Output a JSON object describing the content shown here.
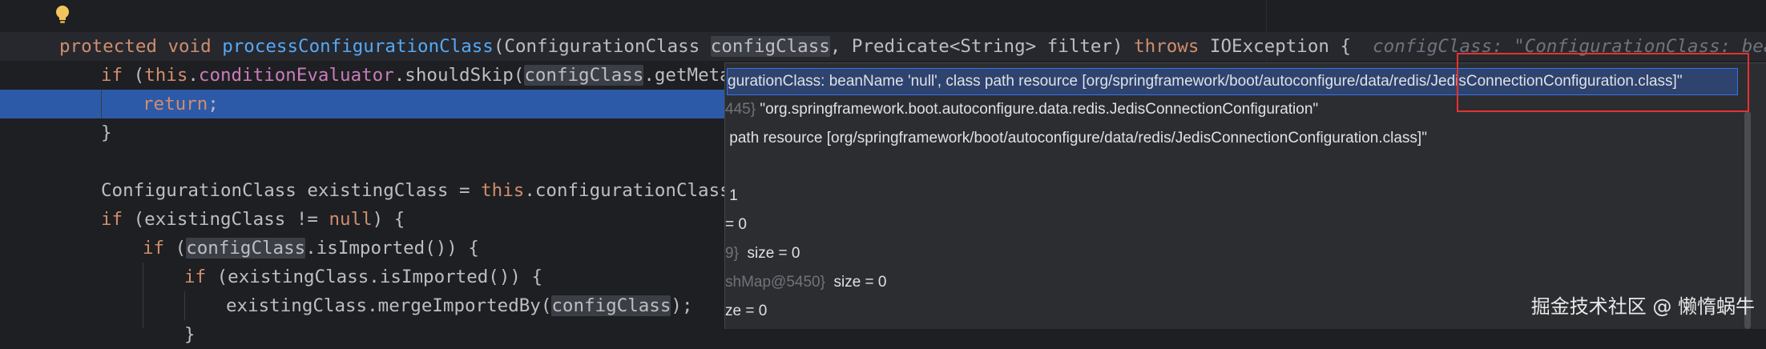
{
  "code": {
    "line1": {
      "kw1": "protected",
      "kw2": "void",
      "method": "processConfigurationClass",
      "paren_open": "(",
      "type1": "ConfigurationClass ",
      "param1": "configClass",
      "rest": ", Predicate<String> filter) ",
      "throws": "throws",
      "exc": " IOException {",
      "hint_name": "configClass: ",
      "hint_value": "\"ConfigurationClass: beanName"
    },
    "line2": {
      "if": "if",
      "open": " (",
      "this": "this",
      "dot": ".",
      "field": "conditionEvaluator",
      "call": ".shouldSkip(",
      "param": "configClass",
      "tail": ".getMetada"
    },
    "line3": {
      "kw": "return",
      "semi": ";"
    },
    "line4": {
      "text": "}"
    },
    "line6": {
      "type": "ConfigurationClass existingClass = ",
      "this": "this",
      "tail": ".configurationClasses"
    },
    "line7": {
      "if": "if",
      "tail": " (existingClass != ",
      "null": "null",
      "end": ") {"
    },
    "line8": {
      "if": "if",
      "open": " (",
      "param": "configClass",
      "tail": ".isImported()) {"
    },
    "line9": {
      "if": "if",
      "tail": " (existingClass.isImported()) {"
    },
    "line10": {
      "head": "existingClass.mergeImportedBy(",
      "param": "configClass",
      "tail": ");"
    },
    "line11": {
      "text": "}"
    }
  },
  "popup": {
    "rows": [
      {
        "text": "gurationClass: beanName 'null', class path resource [org/springframework/boot/autoconfigure/data/redis/JedisConnectionConfiguration.class]\""
      },
      {
        "dim": "445}",
        "text": " \"org.springframework.boot.autoconfigure.data.redis.JedisConnectionConfiguration\""
      },
      {
        "text": " path resource [org/springframework/boot/autoconfigure/data/redis/JedisConnectionConfiguration.class]\""
      },
      {
        "text": ""
      },
      {
        "text": " 1"
      },
      {
        "text": "= 0"
      },
      {
        "dim": "9}",
        "text": "  size = 0"
      },
      {
        "dim": "shMap@5450}",
        "text": "  size = 0"
      },
      {
        "text": "ze = 0"
      }
    ]
  },
  "watermark": "掘金技术社区 @ 懒惰蜗牛",
  "colors": {
    "background": "#1e1f22",
    "keyword": "#cf8e6d",
    "method": "#56a8f5",
    "field": "#c77dbb",
    "execution_line": "#2d5aa8",
    "annotation_box": "#e8312f"
  },
  "icons": {
    "gutter": "lightbulb-icon"
  }
}
